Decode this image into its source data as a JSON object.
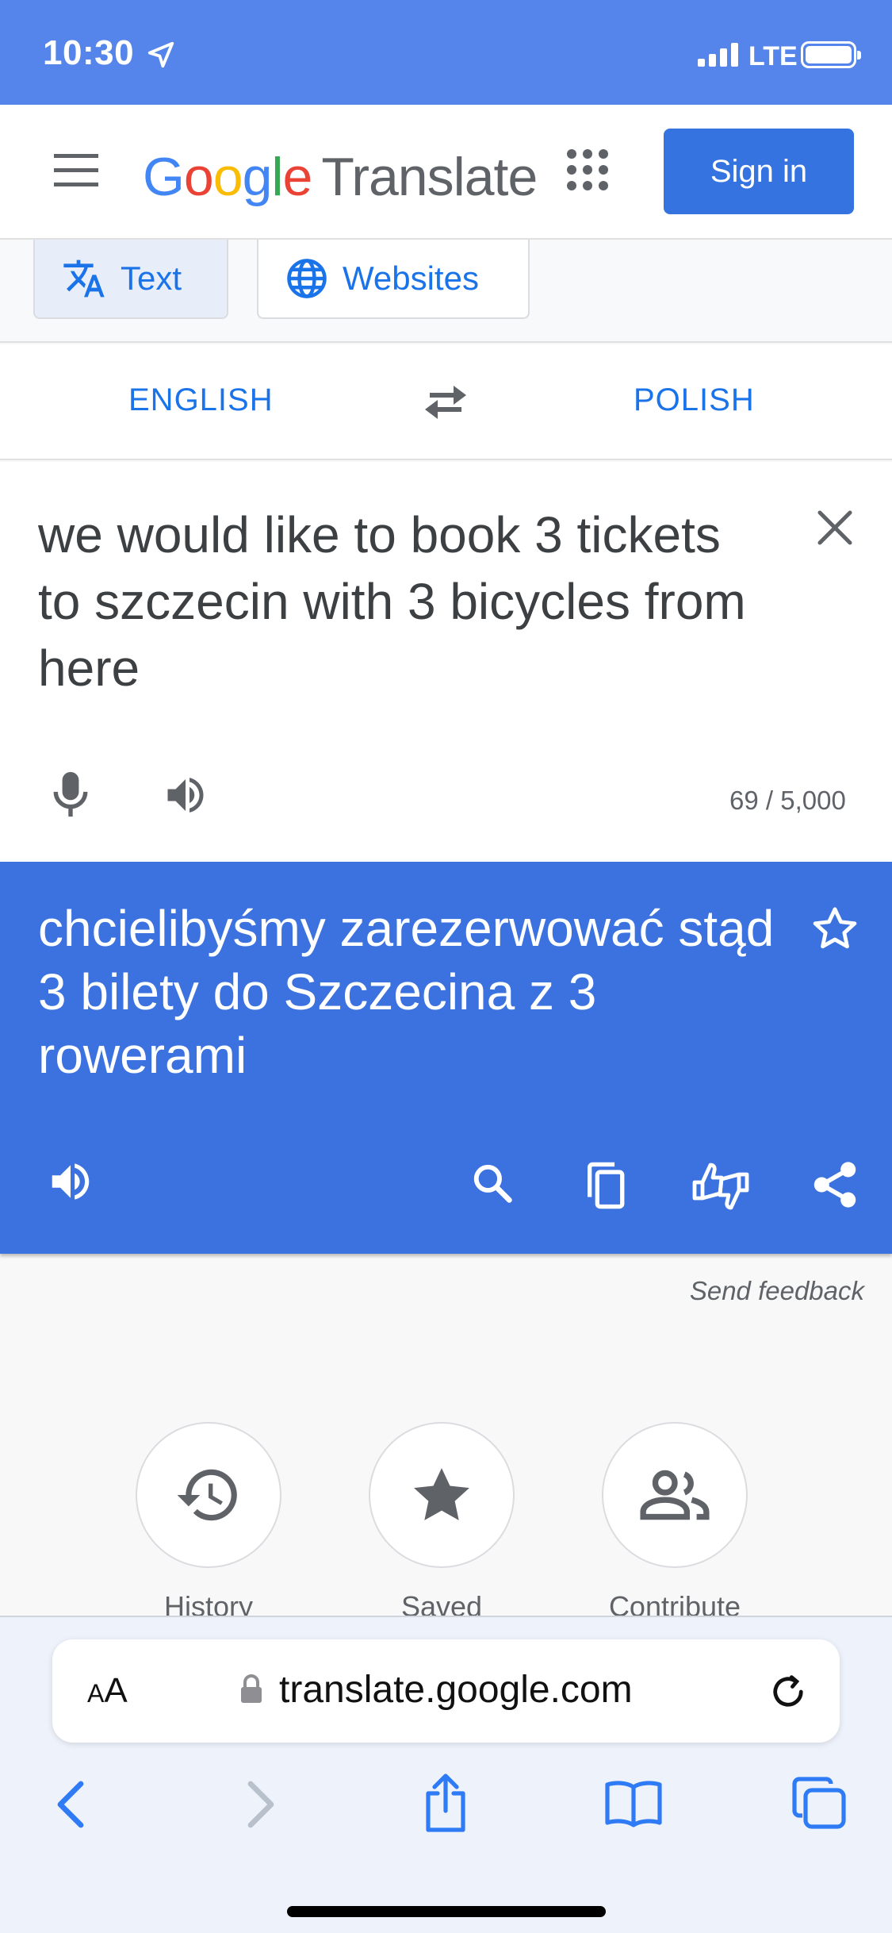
{
  "status_bar": {
    "time": "10:30",
    "network": "LTE"
  },
  "header": {
    "logo_google": [
      "G",
      "o",
      "o",
      "g",
      "l",
      "e"
    ],
    "logo_translate": "Translate",
    "sign_in_label": "Sign in"
  },
  "modes": {
    "text_label": "Text",
    "websites_label": "Websites"
  },
  "languages": {
    "source": "ENGLISH",
    "target": "POLISH"
  },
  "source": {
    "text": "we would like to book 3 tickets to szczecin with 3 bicycles from here",
    "char_count": "69 / 5,000"
  },
  "result": {
    "text": "chcielibyśmy zarezerwować stąd 3 bilety do Szczecina z 3 rowerami"
  },
  "send_feedback": "Send feedback",
  "shortcuts": {
    "history": "History",
    "saved": "Saved",
    "contribute": "Contribute"
  },
  "browser": {
    "aa_small": "A",
    "aa_large": "A",
    "url": "translate.google.com"
  },
  "colors": {
    "status_bar": "#5585ea",
    "accent": "#1a73e8",
    "result_bg": "#3b72e0",
    "sign_in_bg": "#3574e0",
    "google_letters": [
      "#4285f4",
      "#ea4335",
      "#fbbc05",
      "#4285f4",
      "#34a853",
      "#ea4335"
    ]
  },
  "icons": [
    "location-arrow",
    "signal",
    "battery",
    "menu",
    "apps-grid",
    "translate",
    "globe",
    "swap",
    "close",
    "mic",
    "speaker",
    "star-outline",
    "search",
    "copy",
    "feedback",
    "share",
    "history",
    "star",
    "people",
    "lock",
    "reload",
    "back",
    "forward",
    "share-box",
    "book",
    "tabs"
  ]
}
